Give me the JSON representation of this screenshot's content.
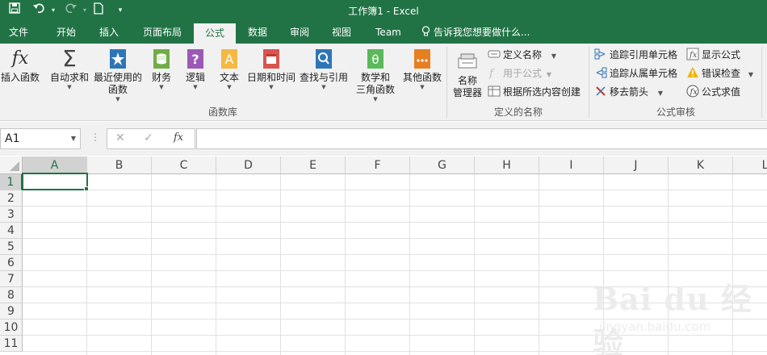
{
  "window": {
    "title": "工作簿1 - Excel"
  },
  "quick_access": {
    "save_icon": "save-icon",
    "undo_icon": "undo-icon",
    "redo_icon": "redo-icon",
    "new_icon": "new-document-icon",
    "customize_icon": "customize-icon"
  },
  "tabs": [
    {
      "label": "文件",
      "active": false
    },
    {
      "label": "开始",
      "active": false
    },
    {
      "label": "插入",
      "active": false
    },
    {
      "label": "页面布局",
      "active": false
    },
    {
      "label": "公式",
      "active": true
    },
    {
      "label": "数据",
      "active": false
    },
    {
      "label": "审阅",
      "active": false
    },
    {
      "label": "视图",
      "active": false
    },
    {
      "label": "Team",
      "active": false
    }
  ],
  "tell_me": "告诉我您想要做什么...",
  "ribbon": {
    "function_library": {
      "group_label": "函数库",
      "insert_function": "插入函数",
      "autosum": "自动求和",
      "recently_used_1": "最近使用的",
      "recently_used_2": "函数",
      "financial": "财务",
      "logical": "逻辑",
      "text": "文本",
      "date_time": "日期和时间",
      "lookup_reference": "查找与引用",
      "math_trig_1": "数学和",
      "math_trig_2": "三角函数",
      "more_functions": "其他函数"
    },
    "defined_names": {
      "group_label": "定义的名称",
      "name_manager_1": "名称",
      "name_manager_2": "管理器",
      "define_name": "定义名称",
      "use_in_formula": "用于公式",
      "create_from_selection": "根据所选内容创建"
    },
    "formula_auditing": {
      "group_label": "公式审核",
      "trace_precedents": "追踪引用单元格",
      "trace_dependents": "追踪从属单元格",
      "remove_arrows": "移去箭头",
      "show_formulas": "显示公式",
      "error_checking": "错误检查",
      "evaluate_formula": "公式求值"
    }
  },
  "formula_bar": {
    "name_box": "A1",
    "formula": ""
  },
  "sheet": {
    "columns": [
      "A",
      "B",
      "C",
      "D",
      "E",
      "F",
      "G",
      "H",
      "I",
      "J",
      "K",
      "L"
    ],
    "rows": [
      "1",
      "2",
      "3",
      "4",
      "5",
      "6",
      "7",
      "8",
      "9",
      "10",
      "11"
    ],
    "selected_cell": "A1"
  },
  "watermark": {
    "brand": "Bai du 经验",
    "url": "jingyan.baidu.com"
  },
  "colors": {
    "accent": "#217346",
    "ribbon_bg": "#f1f1f1"
  }
}
